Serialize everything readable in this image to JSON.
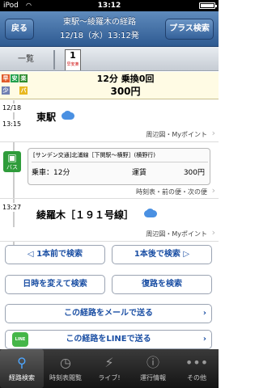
{
  "status_bar": {
    "carrier": "iPod",
    "wifi": "wifi-icon",
    "time": "13:12",
    "battery": "battery-icon"
  },
  "nav": {
    "back_label": "戻る",
    "title_line1": "東駅～綾羅木の経路",
    "title_line2": "12/18（水）13:12発",
    "plus_search_label": "プラス検索"
  },
  "tabs": {
    "list_label": "一覧",
    "route_number": "1",
    "route_tag": "早安楽"
  },
  "summary": {
    "badges": [
      "早",
      "安",
      "楽",
      "少",
      "バ"
    ],
    "duration_transfers": "12分  乗換0回",
    "fare": "300円"
  },
  "route": {
    "departure": {
      "date": "12/18",
      "time": "13:15",
      "station": "東駅",
      "weather_icon": "cloud-icon",
      "links": "周辺図・Myポイント"
    },
    "segment": {
      "icon_label": "バス",
      "line": "[サンデン交通]北浦線［下関駅～横野］(横野行)",
      "ride_label": "乗車：12分",
      "fare_label": "運賃",
      "fare_value": "300円",
      "links": "時刻表・前の便・次の便"
    },
    "arrival": {
      "time": "13:27",
      "station": "綾羅木［１９１号線］",
      "weather_icon": "cloud-icon",
      "links": "周辺図・Myポイント"
    }
  },
  "actions": {
    "prev_label": "◁ 1本前で検索",
    "next_label": "1本後で検索 ▷",
    "change_datetime_label": "日時を変えて検索",
    "return_route_label": "復路を検索",
    "email_label": "この経路をメールで送る",
    "line_label": "この経路をLINEで送る",
    "line_logo_text": "LINE",
    "chevron": "›"
  },
  "tabbar": {
    "items": [
      {
        "label": "経路検索",
        "icon": "search-icon"
      },
      {
        "label": "時刻表閲覧",
        "icon": "clock-icon"
      },
      {
        "label": "ライブ!",
        "icon": "bolt-icon"
      },
      {
        "label": "運行情報",
        "icon": "info-icon"
      },
      {
        "label": "その他",
        "icon": "more-icon"
      }
    ],
    "active_index": 0
  },
  "colors": {
    "nav": "#3d6aa3",
    "accent": "#1b4fa4",
    "summary_bg": "#fffbe4",
    "tabbar_active": "#4da6ff"
  }
}
